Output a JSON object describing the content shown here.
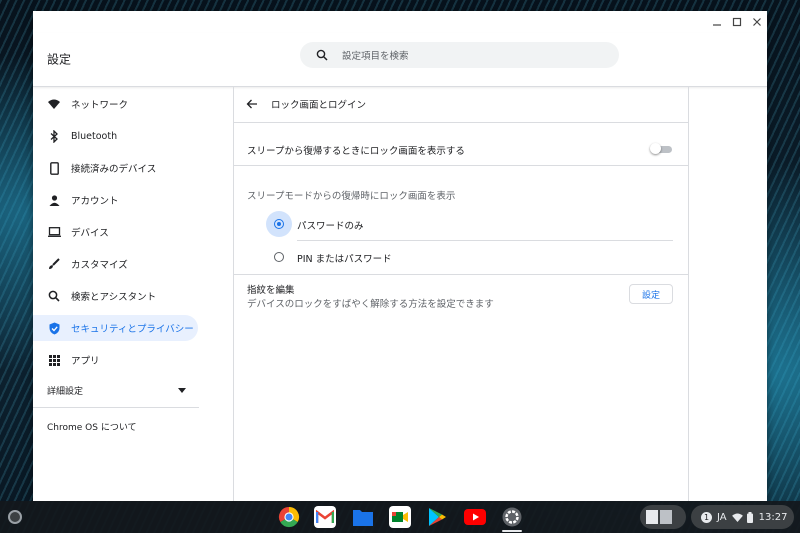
{
  "window": {
    "title": "設定",
    "controls": [
      "minimize",
      "maximize",
      "close"
    ]
  },
  "search": {
    "placeholder": "設定項目を検索"
  },
  "sidebar": {
    "items": [
      {
        "label": "ネットワーク",
        "icon": "wifi-icon"
      },
      {
        "label": "Bluetooth",
        "icon": "bluetooth-icon"
      },
      {
        "label": "接続済みのデバイス",
        "icon": "phone-icon"
      },
      {
        "label": "アカウント",
        "icon": "person-icon"
      },
      {
        "label": "デバイス",
        "icon": "laptop-icon"
      },
      {
        "label": "カスタマイズ",
        "icon": "brush-icon"
      },
      {
        "label": "検索とアシスタント",
        "icon": "search-icon"
      },
      {
        "label": "セキュリティとプライバシー",
        "icon": "shield-icon",
        "active": true
      },
      {
        "label": "アプリ",
        "icon": "apps-grid-icon"
      }
    ],
    "advanced": "詳細設定",
    "about": "Chrome OS について"
  },
  "page": {
    "title": "ロック画面とログイン",
    "wake_toggle_label": "スリープから復帰するときにロック画面を表示する",
    "wake_toggle_on": false,
    "sleep_section_label": "スリープモードからの復帰時にロック画面を表示",
    "radio_options": [
      {
        "label": "パスワードのみ",
        "selected": true
      },
      {
        "label": "PIN またはパスワード",
        "selected": false
      }
    ],
    "fingerprint_title": "指紋を編集",
    "fingerprint_desc": "デバイスのロックをすばやく解除する方法を設定できます",
    "fingerprint_button": "設定"
  },
  "shelf": {
    "apps": [
      "chrome-icon",
      "gmail-icon",
      "files-icon",
      "meet-icon",
      "play-store-icon",
      "youtube-icon",
      "settings-icon"
    ],
    "tray": {
      "notification_count": "1",
      "language": "JA",
      "time": "13:27"
    }
  },
  "colors": {
    "accent": "#1a73e8",
    "active_bg": "#e8f0fe",
    "radio_halo": "#d2e3fc",
    "divider": "#dadce0"
  }
}
